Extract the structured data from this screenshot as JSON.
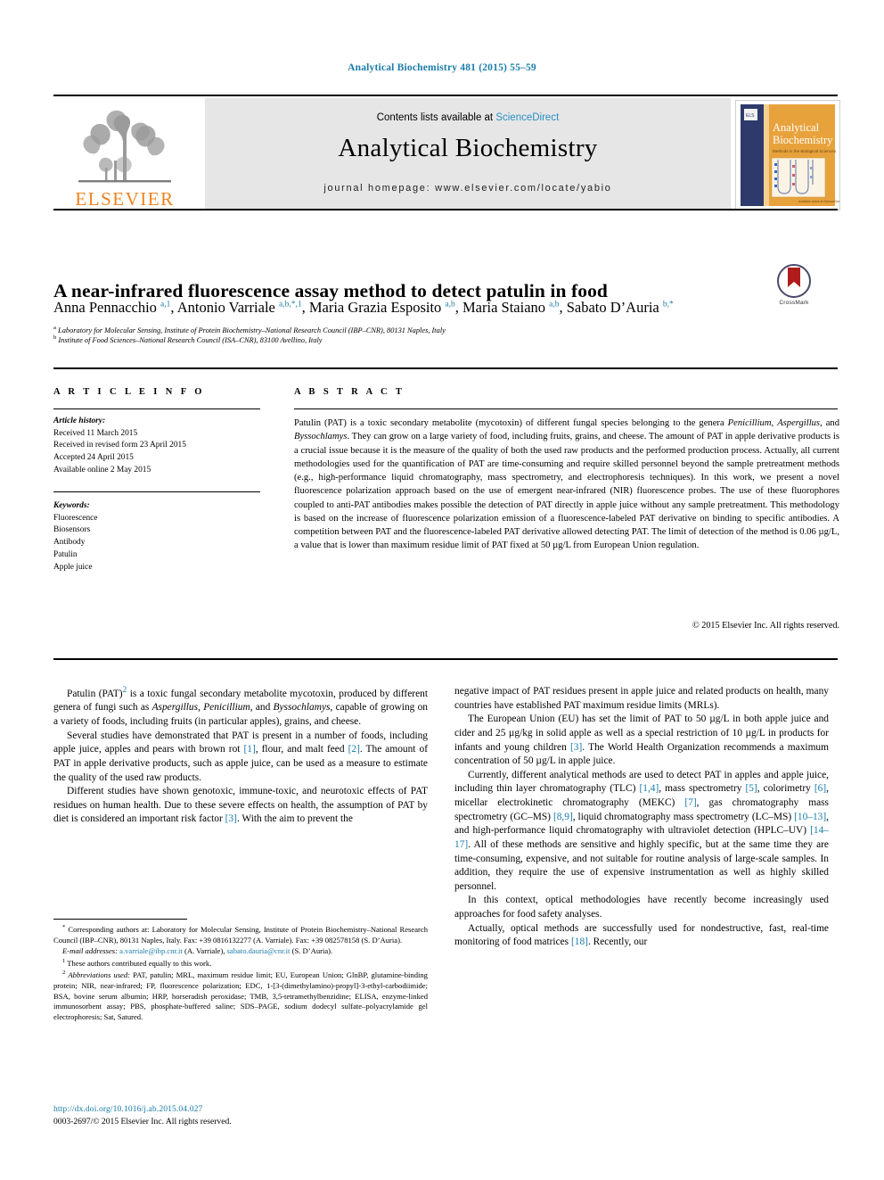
{
  "running_head": "Analytical Biochemistry 481 (2015) 55–59",
  "masthead": {
    "contents_prefix": "Contents lists available at ",
    "sciencedirect": "ScienceDirect",
    "journal_title": "Analytical Biochemistry",
    "homepage": "journal homepage: www.elsevier.com/locate/yabio",
    "publisher_wordmark": "ELSEVIER",
    "cover_title_line1": "Analytical",
    "cover_title_line2": "Biochemistry",
    "cover_subtitle": "Methods in the Biological Sciences"
  },
  "article": {
    "title": "A near-infrared fluorescence assay method to detect patulin in food",
    "crossmark_label": "CrossMark",
    "authors_html": "Anna Pennacchio <sup>a,1</sup>, Antonio Varriale <sup>a,b,*,1</sup>, Maria Grazia Esposito <sup>a,b</sup>, Maria Staiano <sup>a,b</sup>, Sabato D&rsquo;Auria <sup>b,*</sup>",
    "affiliation_a": "Laboratory for Molecular Sensing, Institute of Protein Biochemistry–National Research Council (IBP–CNR), 80131 Naples, Italy",
    "affiliation_b": "Institute of Food Sciences–National Research Council (ISA–CNR), 83100 Avellino, Italy",
    "affiliation_a_marker": "a",
    "affiliation_b_marker": "b"
  },
  "info": {
    "heading": "A R T I C L E   I N F O",
    "history_label": "Article history:",
    "history": [
      "Received 11 March 2015",
      "Received in revised form 23 April 2015",
      "Accepted 24 April 2015",
      "Available online 2 May 2015"
    ],
    "keywords_label": "Keywords:",
    "keywords": [
      "Fluorescence",
      "Biosensors",
      "Antibody",
      "Patulin",
      "Apple juice"
    ]
  },
  "abstract": {
    "heading": "A B S T R A C T",
    "body_html": "Patulin (PAT) is a toxic secondary metabolite (mycotoxin) of different fungal species belonging to the genera <i>Penicillium</i>, <i>Aspergillus</i>, and <i>Byssochlamys</i>. They can grow on a large variety of food, including fruits, grains, and cheese. The amount of PAT in apple derivative products is a crucial issue because it is the measure of the quality of both the used raw products and the performed production process. Actually, all current methodologies used for the quantification of PAT are time-consuming and require skilled personnel beyond the sample pretreatment methods (e.g., high-performance liquid chromatography, mass spectrometry, and electrophoresis techniques). In this work, we present a novel fluorescence polarization approach based on the use of emergent near-infrared (NIR) fluorescence probes. The use of these fluorophores coupled to anti-PAT antibodies makes possible the detection of PAT directly in apple juice without any sample pretreatment. This methodology is based on the increase of fluorescence polarization emission of a fluorescence-labeled PAT derivative on binding to specific antibodies. A competition between PAT and the fluorescence-labeled PAT derivative allowed detecting PAT. The limit of detection of the method is 0.06 &micro;g/L, a value that is lower than maximum residue limit of PAT fixed at 50 &micro;g/L from European Union regulation.",
    "copyright": "© 2015 Elsevier Inc. All rights reserved."
  },
  "body": {
    "left_html": "<p>Patulin (PAT)<sup class=\"ref\">2</sup> is a toxic fungal secondary metabolite mycotoxin, produced by different genera of fungi such as <i>Aspergillus</i>, <i>Penicillium</i>, and <i>Byssochlamys</i>, capable of growing on a variety of foods, including fruits (in particular apples), grains, and cheese.</p><p>Several studies have demonstrated that PAT is present in a number of foods, including apple juice, apples and pears with brown rot <span class=\"ref\">[1]</span>, flour, and malt feed <span class=\"ref\">[2]</span>. The amount of PAT in apple derivative products, such as apple juice, can be used as a measure to estimate the quality of the used raw products.</p><p>Different studies have shown genotoxic, immune-toxic, and neurotoxic effects of PAT residues on human health. Due to these severe effects on health, the assumption of PAT by diet is considered an important risk factor <span class=\"ref\">[3]</span>. With the aim to prevent the</p>",
    "right_html": "<p class=\"noind\">negative impact of PAT residues present in apple juice and related products on health, many countries have established PAT maximum residue limits (MRLs).</p><p>The European Union (EU) has set the limit of PAT to 50 &micro;g/L in both apple juice and cider and 25 &micro;g/kg in solid apple as well as a special restriction of 10 &micro;g/L in products for infants and young children <span class=\"ref\">[3]</span>. The World Health Organization recommends a maximum concentration of 50 &micro;g/L in apple juice.</p><p>Currently, different analytical methods are used to detect PAT in apples and apple juice, including thin layer chromatography (TLC) <span class=\"ref\">[1,4]</span>, mass spectrometry <span class=\"ref\">[5]</span>, colorimetry <span class=\"ref\">[6]</span>, micellar electrokinetic chromatography (MEKC) <span class=\"ref\">[7]</span>, gas chromatography mass spectrometry (GC–MS) <span class=\"ref\">[8,9]</span>, liquid chromatography mass spectrometry (LC–MS) <span class=\"ref\">[10–13]</span>, and high-performance liquid chromatography with ultraviolet detection (HPLC–UV) <span class=\"ref\">[14–17]</span>. All of these methods are sensitive and highly specific, but at the same time they are time-consuming, expensive, and not suitable for routine analysis of large-scale samples. In addition, they require the use of expensive instrumentation as well as highly skilled personnel.</p><p>In this context, optical methodologies have recently become increasingly used approaches for food safety analyses.</p><p>Actually, optical methods are successfully used for nondestructive, fast, real-time monitoring of food matrices <span class=\"ref\">[18]</span>. Recently, our</p>"
  },
  "footnotes": {
    "corresponding_html": "<sup>*</sup> Corresponding authors at: Laboratory for Molecular Sensing, Institute of Protein Biochemistry–National Research Council (IBP–CNR), 80131 Naples, Italy. Fax: +39 0816132277 (A. Varriale). Fax: +39 082578158 (S. D&rsquo;Auria).",
    "email_html": "<span class=\"it\">E-mail addresses:</span> <span class=\"mail\">a.varriale@ibp.cnr.it</span> (A. Varriale), <span class=\"mail\">sabato.dauria@cnr.it</span> (S. D&rsquo;Auria).",
    "note1_html": "<sup>1</sup> These authors contributed equally to this work.",
    "note2_html": "<sup>2</sup> <span class=\"it\">Abbreviations used:</span> PAT, patulin; MRL, maximum residue limit; EU, European Union; GlnBP, glutamine-binding protein; NIR, near-infrared; FP, fluorescence polarization; EDC, 1-[3-(dimethylamino)-propyl]-3-ethyl-carbodiimide; BSA, bovine serum albumin; HRP, horseradish peroxidase; TMB, 3,5-tetramethylbenzidine; ELISA, enzyme-linked immunosorbent assay; PBS, phosphate-buffered saline; SDS–PAGE, sodium dodecyl sulfate–polyacrylamide gel electrophoresis; Sat, Satured."
  },
  "footer": {
    "doi": "http://dx.doi.org/10.1016/j.ab.2015.04.027",
    "issn_copyright": "0003-2697/© 2015 Elsevier Inc. All rights reserved."
  },
  "colors": {
    "link_blue": "#1a7ca8",
    "elsevier_orange": "#f0821e",
    "masthead_grey": "#e6e6e6"
  }
}
